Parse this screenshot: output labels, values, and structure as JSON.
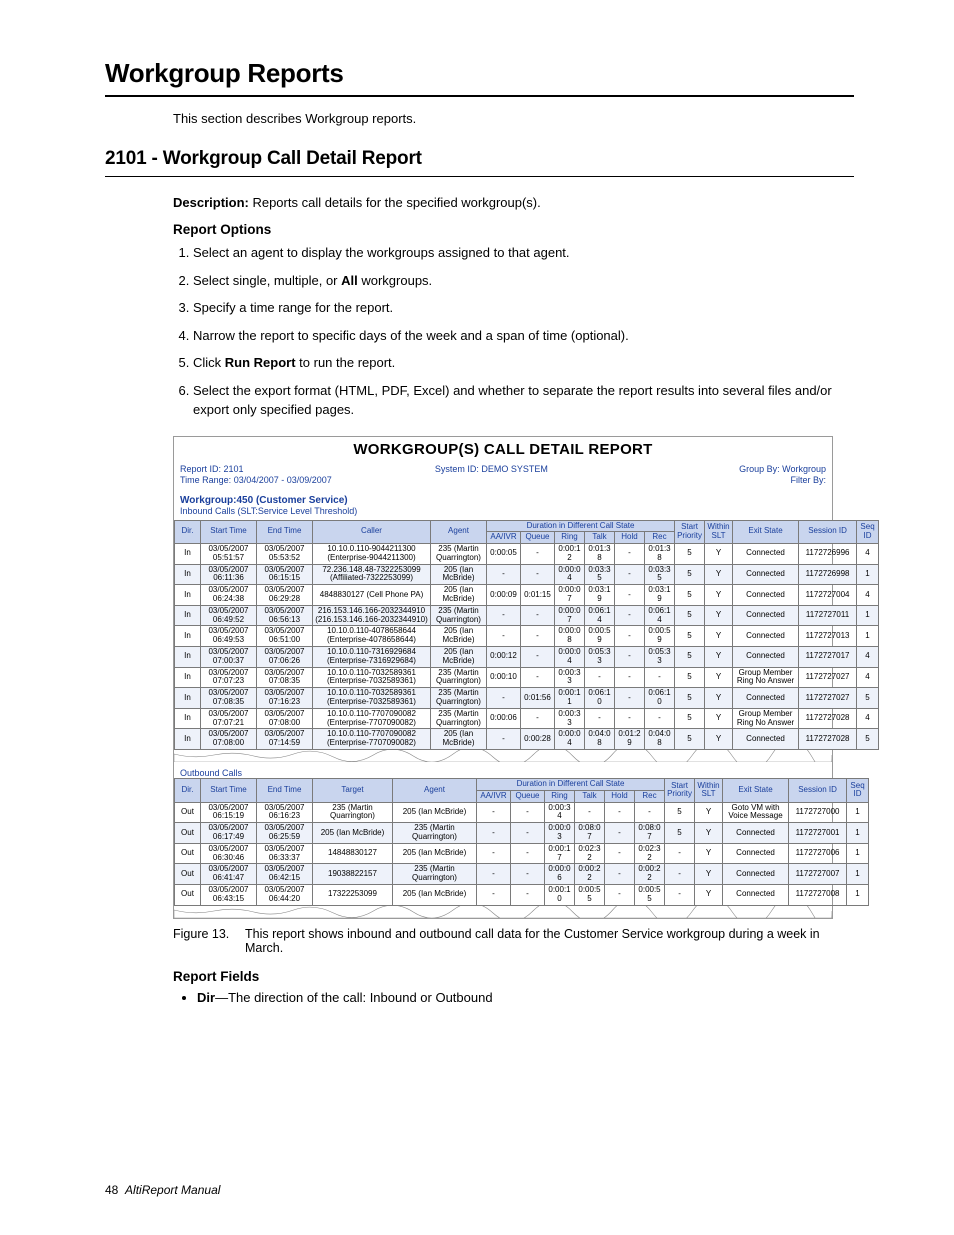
{
  "h1": "Workgroup Reports",
  "intro": "This section describes Workgroup reports.",
  "h2": "2101 - Workgroup Call Detail Report",
  "desc_label": "Description:",
  "desc_text": " Reports call details for the specified workgroup(s).",
  "h3a": "Report Options",
  "opts": [
    {
      "pre": "Select an agent to display the workgroups assigned to that agent."
    },
    {
      "pre": "Select single, multiple, or ",
      "bold": "All",
      "post": " workgroups."
    },
    {
      "pre": "Specify a time range for the report."
    },
    {
      "pre": "Narrow the report to specific days of the week and a span of time (optional)."
    },
    {
      "pre": "Click ",
      "bold": "Run Report",
      "post": " to run the report."
    },
    {
      "pre": "Select the export format (HTML, PDF, Excel) and whether to separate the report results into several files and/or export only specified pages."
    }
  ],
  "fig": {
    "title": "WORKGROUP(S) CALL DETAIL REPORT",
    "report_id": "Report ID: 2101",
    "system_id": "System ID: DEMO SYSTEM",
    "group_by": "Group By: Workgroup",
    "time_range": "Time Range: 03/04/2007 - 03/09/2007",
    "filter_by": "Filter By:",
    "wg": "Workgroup:450 (Customer Service)",
    "inbound_label": "Inbound Calls (SLT:Service Level Threshold)",
    "dur_hdr": "Duration in Different Call State",
    "cols": [
      "Dir.",
      "Start Time",
      "End Time",
      "Caller",
      "Agent",
      "AA/IVR",
      "Queue",
      "Ring",
      "Talk",
      "Hold",
      "Rec",
      "Start Priority",
      "Within SLT",
      "Exit State",
      "Session ID",
      "Seq ID"
    ],
    "inbound": [
      {
        "dir": "In",
        "s": "03/05/2007 05:51:57",
        "e": "03/05/2007 05:53:52",
        "caller": "10.10.0.110-9044211300 (Enterprise-9044211300)",
        "agent": "235 (Martin Quarrington)",
        "aa": "0:00:05",
        "q": "-",
        "ring": "0:00:12",
        "talk": "0:01:38",
        "hold": "-",
        "rec": "0:01:38",
        "pr": "5",
        "slt": "Y",
        "exit": "Connected",
        "sess": "1172726996",
        "seq": "4"
      },
      {
        "dir": "In",
        "s": "03/05/2007 06:11:36",
        "e": "03/05/2007 06:15:15",
        "caller": "72.236.148.48-7322253099 (Affiliated-7322253099)",
        "agent": "205 (Ian McBride)",
        "aa": "-",
        "q": "-",
        "ring": "0:00:04",
        "talk": "0:03:35",
        "hold": "-",
        "rec": "0:03:35",
        "pr": "5",
        "slt": "Y",
        "exit": "Connected",
        "sess": "1172726998",
        "seq": "1"
      },
      {
        "dir": "In",
        "s": "03/05/2007 06:24:38",
        "e": "03/05/2007 06:29:28",
        "caller": "4848830127 (Cell Phone PA)",
        "agent": "205 (Ian McBride)",
        "aa": "0:00:09",
        "q": "0:01:15",
        "ring": "0:00:07",
        "talk": "0:03:19",
        "hold": "-",
        "rec": "0:03:19",
        "pr": "5",
        "slt": "Y",
        "exit": "Connected",
        "sess": "1172727004",
        "seq": "4"
      },
      {
        "dir": "In",
        "s": "03/05/2007 06:49:52",
        "e": "03/05/2007 06:56:13",
        "caller": "216.153.146.166-2032344910 (216.153.146.166-2032344910)",
        "agent": "235 (Martin Quarrington)",
        "aa": "-",
        "q": "-",
        "ring": "0:00:07",
        "talk": "0:06:14",
        "hold": "-",
        "rec": "0:06:14",
        "pr": "5",
        "slt": "Y",
        "exit": "Connected",
        "sess": "1172727011",
        "seq": "1"
      },
      {
        "dir": "In",
        "s": "03/05/2007 06:49:53",
        "e": "03/05/2007 06:51:00",
        "caller": "10.10.0.110-4078658644 (Enterprise-4078658644)",
        "agent": "205 (Ian McBride)",
        "aa": "-",
        "q": "-",
        "ring": "0:00:08",
        "talk": "0:00:59",
        "hold": "-",
        "rec": "0:00:59",
        "pr": "5",
        "slt": "Y",
        "exit": "Connected",
        "sess": "1172727013",
        "seq": "1"
      },
      {
        "dir": "In",
        "s": "03/05/2007 07:00:37",
        "e": "03/05/2007 07:06:26",
        "caller": "10.10.0.110-7316929684 (Enterprise-7316929684)",
        "agent": "205 (Ian McBride)",
        "aa": "0:00:12",
        "q": "-",
        "ring": "0:00:04",
        "talk": "0:05:33",
        "hold": "-",
        "rec": "0:05:33",
        "pr": "5",
        "slt": "Y",
        "exit": "Connected",
        "sess": "1172727017",
        "seq": "4"
      },
      {
        "dir": "In",
        "s": "03/05/2007 07:07:23",
        "e": "03/05/2007 07:08:35",
        "caller": "10.10.0.110-7032589361 (Enterprise-7032589361)",
        "agent": "235 (Martin Quarrington)",
        "aa": "0:00:10",
        "q": "-",
        "ring": "0:00:33",
        "talk": "-",
        "hold": "-",
        "rec": "-",
        "pr": "5",
        "slt": "Y",
        "exit": "Group Member Ring No Answer",
        "sess": "1172727027",
        "seq": "4"
      },
      {
        "dir": "In",
        "s": "03/05/2007 07:08:35",
        "e": "03/05/2007 07:16:23",
        "caller": "10.10.0.110-7032589361 (Enterprise-7032589361)",
        "agent": "235 (Martin Quarrington)",
        "aa": "-",
        "q": "0:01:56",
        "ring": "0:00:11",
        "talk": "0:06:10",
        "hold": "-",
        "rec": "0:06:10",
        "pr": "5",
        "slt": "Y",
        "exit": "Connected",
        "sess": "1172727027",
        "seq": "5"
      },
      {
        "dir": "In",
        "s": "03/05/2007 07:07:21",
        "e": "03/05/2007 07:08:00",
        "caller": "10.10.0.110-7707090082 (Enterprise-7707090082)",
        "agent": "235 (Martin Quarrington)",
        "aa": "0:00:06",
        "q": "-",
        "ring": "0:00:33",
        "talk": "-",
        "hold": "-",
        "rec": "-",
        "pr": "5",
        "slt": "Y",
        "exit": "Group Member Ring No Answer",
        "sess": "1172727028",
        "seq": "4"
      },
      {
        "dir": "In",
        "s": "03/05/2007 07:08:00",
        "e": "03/05/2007 07:14:59",
        "caller": "10.10.0.110-7707090082 (Enterprise-7707090082)",
        "agent": "205 (Ian McBride)",
        "aa": "-",
        "q": "0:00:28",
        "ring": "0:00:04",
        "talk": "0:04:08",
        "hold": "0:01:29",
        "rec": "0:04:08",
        "pr": "5",
        "slt": "Y",
        "exit": "Connected",
        "sess": "1172727028",
        "seq": "5"
      }
    ],
    "outbound_label": "Outbound Calls",
    "cols2": [
      "Dir.",
      "Start Time",
      "End Time",
      "Target",
      "Agent",
      "AA/IVR",
      "Queue",
      "Ring",
      "Talk",
      "Hold",
      "Rec",
      "Start Priority",
      "Within SLT",
      "Exit State",
      "Session ID",
      "Seq ID"
    ],
    "outbound": [
      {
        "dir": "Out",
        "s": "03/05/2007 06:15:19",
        "e": "03/05/2007 06:16:23",
        "target": "235 (Martin Quarrington)",
        "agent": "205 (Ian McBride)",
        "aa": "-",
        "q": "-",
        "ring": "0:00:34",
        "talk": "-",
        "hold": "-",
        "rec": "-",
        "pr": "5",
        "slt": "Y",
        "exit": "Goto VM with Voice Message",
        "sess": "1172727000",
        "seq": "1"
      },
      {
        "dir": "Out",
        "s": "03/05/2007 06:17:49",
        "e": "03/05/2007 06:25:59",
        "target": "205 (Ian McBride)",
        "agent": "235 (Martin Quarrington)",
        "aa": "-",
        "q": "-",
        "ring": "0:00:03",
        "talk": "0:08:07",
        "hold": "-",
        "rec": "0:08:07",
        "pr": "5",
        "slt": "Y",
        "exit": "Connected",
        "sess": "1172727001",
        "seq": "1"
      },
      {
        "dir": "Out",
        "s": "03/05/2007 06:30:46",
        "e": "03/05/2007 06:33:37",
        "target": "14848830127",
        "agent": "205 (Ian McBride)",
        "aa": "-",
        "q": "-",
        "ring": "0:00:17",
        "talk": "0:02:32",
        "hold": "-",
        "rec": "0:02:32",
        "pr": "-",
        "slt": "Y",
        "exit": "Connected",
        "sess": "1172727006",
        "seq": "1"
      },
      {
        "dir": "Out",
        "s": "03/05/2007 06:41:47",
        "e": "03/05/2007 06:42:15",
        "target": "19038822157",
        "agent": "235 (Martin Quarrington)",
        "aa": "-",
        "q": "-",
        "ring": "0:00:06",
        "talk": "0:00:22",
        "hold": "-",
        "rec": "0:00:22",
        "pr": "-",
        "slt": "Y",
        "exit": "Connected",
        "sess": "1172727007",
        "seq": "1"
      },
      {
        "dir": "Out",
        "s": "03/05/2007 06:43:15",
        "e": "03/05/2007 06:44:20",
        "target": "17322253099",
        "agent": "205 (Ian McBride)",
        "aa": "-",
        "q": "-",
        "ring": "0:00:10",
        "talk": "0:00:55",
        "hold": "-",
        "rec": "0:00:55",
        "pr": "-",
        "slt": "Y",
        "exit": "Connected",
        "sess": "1172727008",
        "seq": "1"
      }
    ]
  },
  "caption_label": "Figure 13.",
  "caption_text": "This report shows inbound and outbound call data for the Customer Service workgroup during a week in March.",
  "h3b": "Report Fields",
  "field_name": "Dir",
  "field_desc": "—The direction of the call: Inbound or Outbound",
  "footer_page": "48",
  "footer_text": "AltiReport Manual"
}
